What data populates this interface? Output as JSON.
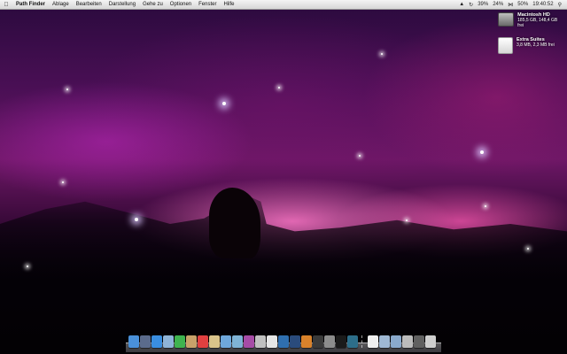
{
  "menubar": {
    "apple_icon": "apple-logo-icon",
    "app_name": "Path Finder",
    "menus": [
      "Ablage",
      "Bearbeiten",
      "Darstellung",
      "Gehe zu",
      "Optionen",
      "Fenster",
      "Hilfe"
    ],
    "tray": {
      "cpu": "39%",
      "temp": "24%",
      "battery": "50%",
      "clock": "19:40:52"
    }
  },
  "desktop_volumes": [
    {
      "name": "Macintosh HD",
      "info": "185,5 GB, 148,4 GB frei"
    },
    {
      "name": "Extra Suites",
      "info": "3,8 MB, 2,3 MB frei"
    }
  ],
  "dock": {
    "apps": [
      {
        "name": "finder-icon",
        "color": "#4a90d9"
      },
      {
        "name": "dashboard-icon",
        "color": "#5b6b8c"
      },
      {
        "name": "safari-icon",
        "color": "#3a8ee0"
      },
      {
        "name": "mail-icon",
        "color": "#8fb4d8"
      },
      {
        "name": "ichat-icon",
        "color": "#3fb34f"
      },
      {
        "name": "address-book-icon",
        "color": "#c8a26a"
      },
      {
        "name": "ical-icon",
        "color": "#e04040"
      },
      {
        "name": "preview-icon",
        "color": "#d9c38a"
      },
      {
        "name": "itunes-icon",
        "color": "#6fa8dc"
      },
      {
        "name": "iphoto-icon",
        "color": "#7fb3d5"
      },
      {
        "name": "imovie-icon",
        "color": "#a64ca6"
      },
      {
        "name": "garageband-icon",
        "color": "#c0c0c0"
      },
      {
        "name": "textedit-icon",
        "color": "#e6e6e6"
      },
      {
        "name": "network-icon",
        "color": "#2f6fb0"
      },
      {
        "name": "photoshop-icon",
        "color": "#2a4b7c"
      },
      {
        "name": "illustrator-icon",
        "color": "#d9822b"
      },
      {
        "name": "activity-monitor-icon",
        "color": "#3a3a3a"
      },
      {
        "name": "system-preferences-icon",
        "color": "#8c8c8c"
      },
      {
        "name": "terminal-icon",
        "color": "#1a1a1a"
      },
      {
        "name": "time-machine-icon",
        "color": "#2d6e8a"
      }
    ],
    "docs": [
      {
        "name": "document-icon",
        "color": "#f0f0f0"
      },
      {
        "name": "applications-folder-icon",
        "color": "#9fb8d4"
      },
      {
        "name": "downloads-folder-icon",
        "color": "#8aa9cc"
      },
      {
        "name": "stack-icon",
        "color": "#bcbcbc"
      },
      {
        "name": "image-stack-icon",
        "color": "#606060"
      },
      {
        "name": "trash-icon",
        "color": "#cfcfcf"
      }
    ]
  }
}
